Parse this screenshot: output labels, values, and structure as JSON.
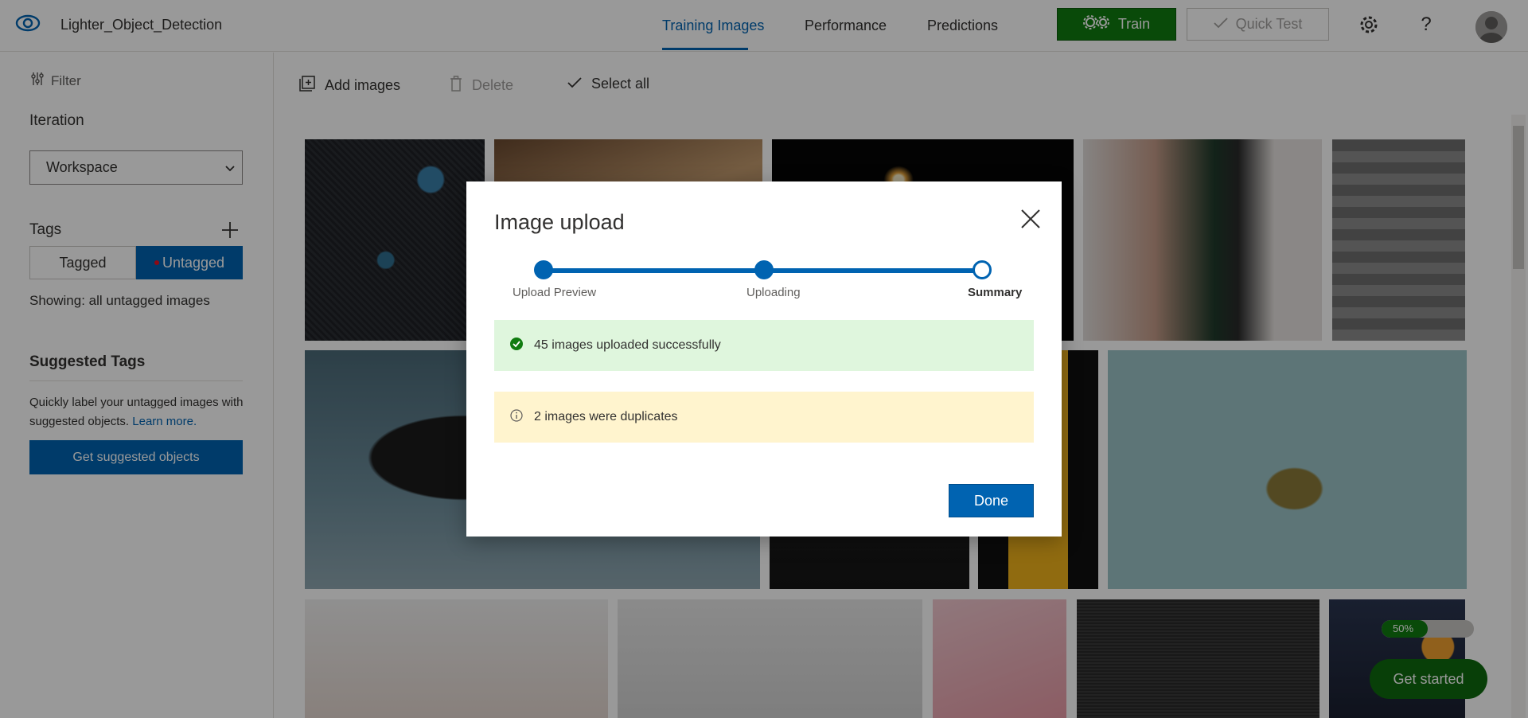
{
  "header": {
    "project_name": "Lighter_Object_Detection",
    "tabs": [
      {
        "label": "Training Images",
        "active": true
      },
      {
        "label": "Performance",
        "active": false
      },
      {
        "label": "Predictions",
        "active": false
      }
    ],
    "train_label": "Train",
    "quick_test_label": "Quick Test",
    "icons": [
      "eye-logo-icon",
      "gear-icon",
      "help-icon",
      "avatar"
    ]
  },
  "sidebar": {
    "filter_label": "Filter",
    "iteration_heading": "Iteration",
    "iteration_value": "Workspace",
    "tags_heading": "Tags",
    "tagged_label": "Tagged",
    "untagged_label": "Untagged",
    "showing_text": "Showing: all untagged images",
    "suggested_heading": "Suggested Tags",
    "suggested_desc": "Quickly label your untagged images with suggested objects.",
    "learn_more": "Learn more.",
    "suggest_button": "Get suggested objects"
  },
  "toolbar": {
    "add_images": "Add images",
    "delete": "Delete",
    "select_all": "Select all"
  },
  "onboarding": {
    "progress_percent": 50,
    "progress_label": "50%",
    "get_started": "Get started"
  },
  "modal": {
    "title": "Image upload",
    "steps": [
      {
        "label": "Upload Preview",
        "state": "done"
      },
      {
        "label": "Uploading",
        "state": "done"
      },
      {
        "label": "Summary",
        "state": "current"
      }
    ],
    "success_message": "45 images uploaded successfully",
    "warning_message": "2 images were duplicates",
    "done_button": "Done"
  },
  "colors": {
    "accent": "#0063b1",
    "train_green": "#107c10",
    "success_bg": "#dff6dd",
    "warning_bg": "#fff4ce"
  }
}
